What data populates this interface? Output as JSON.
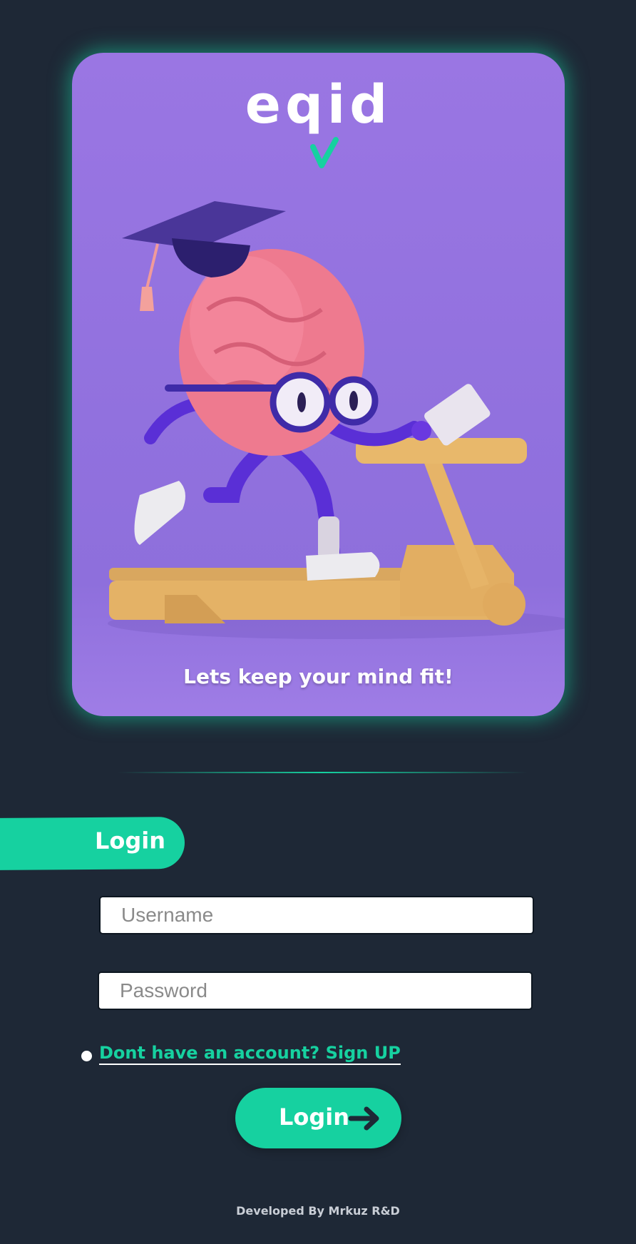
{
  "hero": {
    "logo_text": "eqid",
    "tagline": "Lets keep your mind fit!"
  },
  "login_tab": {
    "label": "Login"
  },
  "form": {
    "username": {
      "placeholder": "Username",
      "value": ""
    },
    "password": {
      "placeholder": "Password",
      "value": ""
    },
    "signup_link": "Dont have an account? Sign UP",
    "submit_label": "Login"
  },
  "footer": {
    "credit": "Developed By Mrkuz R&D"
  },
  "colors": {
    "background": "#1e2836",
    "accent": "#16d1a0",
    "hero_purple": "#9171de"
  },
  "icons": {
    "submit": "arrow-right-icon",
    "bullet": "bullet-dot"
  }
}
